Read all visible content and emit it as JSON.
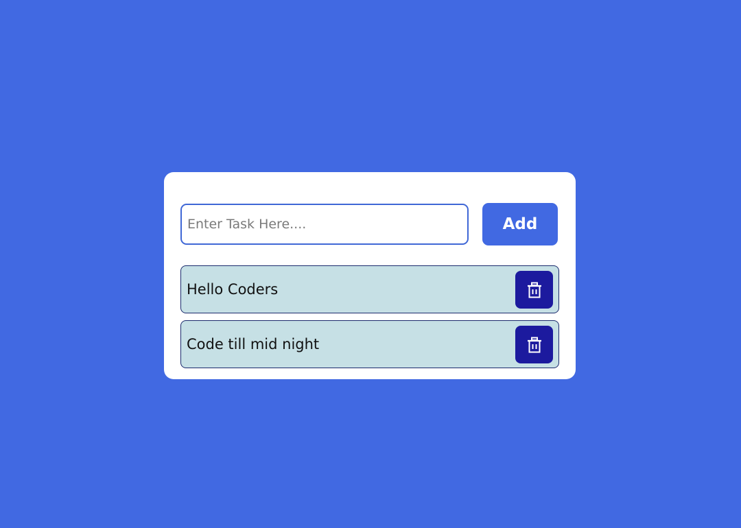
{
  "todo": {
    "input": {
      "placeholder": "Enter Task Here....",
      "value": ""
    },
    "add_label": "Add",
    "tasks": [
      {
        "text": "Hello Coders",
        "delete_icon": "trash-icon"
      },
      {
        "text": "Code till mid night",
        "delete_icon": "trash-icon"
      }
    ]
  },
  "colors": {
    "background": "#4169e2",
    "card": "#ffffff",
    "accent": "#4169e2",
    "task_bg": "#c6e0e5",
    "delete_bg": "#1c1a9e"
  }
}
